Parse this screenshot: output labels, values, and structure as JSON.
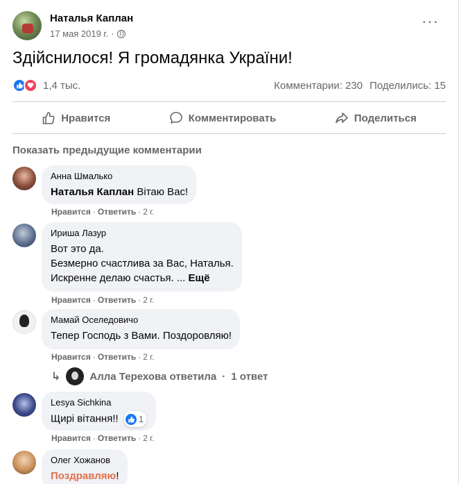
{
  "post": {
    "author": "Наталья Каплан",
    "date": "17 мая 2019 г.",
    "date_separator": "·",
    "more_label": "···",
    "text": "Здійснилося! Я громадянка України!",
    "reaction_count": "1,4 тыс.",
    "comments_count": "Комментарии: 230",
    "shares_count": "Поделились: 15"
  },
  "actions": {
    "like": "Нравится",
    "comment": "Комментировать",
    "share": "Поделиться"
  },
  "comments_section": {
    "show_previous": "Показать предыдущие комментарии",
    "like_label": "Нравится",
    "reply_label": "Ответить",
    "separator": "·"
  },
  "comments": [
    {
      "author": "Анна Шмалько",
      "mention": "Наталья Каплан",
      "text": " Вітаю Вас!",
      "time": "2 г."
    },
    {
      "author": "Ириша Лазур",
      "lines": [
        "Вот это да.",
        "Безмерно счастлива за Вас, Наталья.",
        "Искренне делаю счастья. ..."
      ],
      "see_more": "Ещё",
      "time": "2 г."
    },
    {
      "author": "Мамай Оселедовичо",
      "text": "Тепер Господь з Вами. Поздоровляю!",
      "time": "2 г.",
      "reply_summary": {
        "text": "Алла Терехова ответила",
        "separator": "·",
        "count": "1 ответ"
      }
    },
    {
      "author": "Lesya Sichkina",
      "text": "Щирі вітання!!",
      "reaction_count": "1",
      "time": "2 г."
    },
    {
      "author": "Олег Хожанов",
      "highlight": "Поздравляю",
      "text_after": "!"
    }
  ],
  "colors": {
    "like_blue": "#1877f2",
    "love_red": "#f33e58",
    "secondary_text": "#65676b",
    "bubble_bg": "#f0f2f5",
    "highlight_orange": "#e4704a"
  }
}
